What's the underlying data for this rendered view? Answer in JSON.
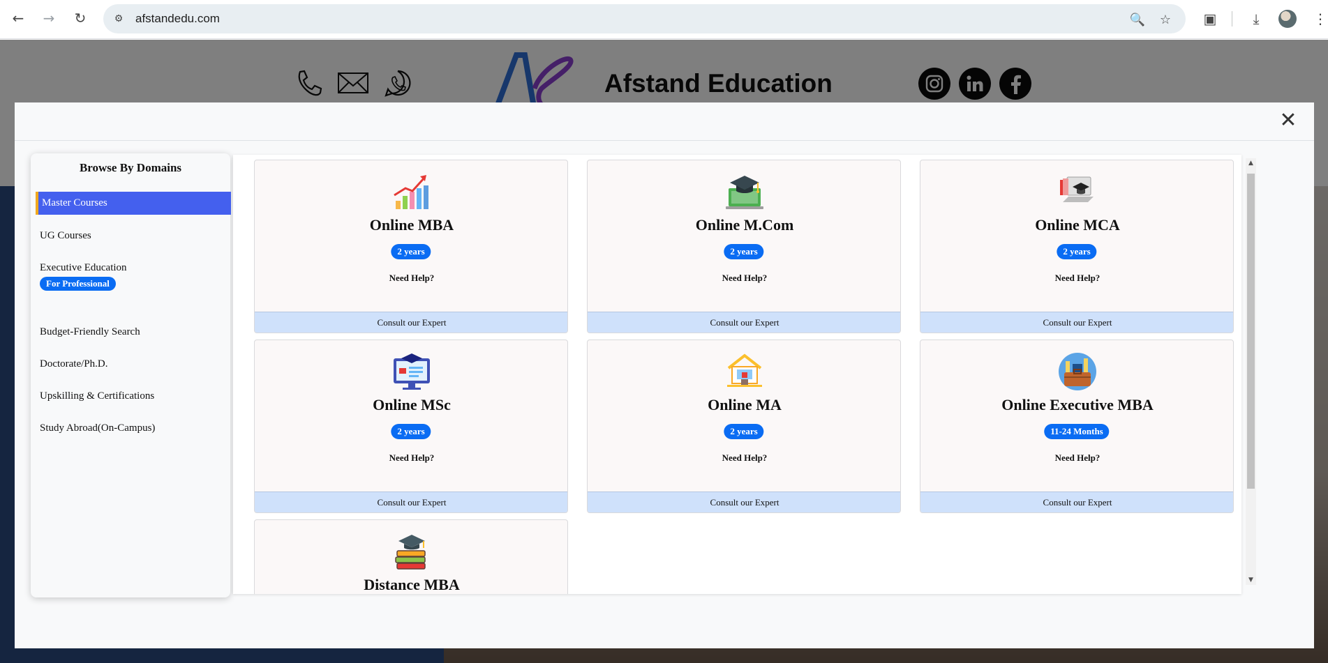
{
  "browser": {
    "url": "afstandedu.com"
  },
  "site": {
    "brand": "Afstand Education"
  },
  "modal": {
    "sidebar": {
      "title": "Browse By Domains",
      "items": [
        {
          "label": "Master Courses",
          "active": true
        },
        {
          "label": "UG Courses"
        },
        {
          "label": "Executive Education",
          "badge": "For Professional"
        },
        {
          "label": "Budget-Friendly Search"
        },
        {
          "label": "Doctorate/Ph.D."
        },
        {
          "label": "Upskilling & Certifications"
        },
        {
          "label": "Study Abroad(On-Campus)"
        }
      ]
    },
    "courses": [
      {
        "title": "Online MBA",
        "duration": "2 years",
        "help": "Need Help?",
        "cta": "Consult our Expert",
        "icon": "growth-chart-icon"
      },
      {
        "title": "Online M.Com",
        "duration": "2 years",
        "help": "Need Help?",
        "cta": "Consult our Expert",
        "icon": "laptop-graduation-cap-icon"
      },
      {
        "title": "Online MCA",
        "duration": "2 years",
        "help": "Need Help?",
        "cta": "Consult our Expert",
        "icon": "laptop-books-cap-icon"
      },
      {
        "title": "Online MSc",
        "duration": "2 years",
        "help": "Need Help?",
        "cta": "Consult our Expert",
        "icon": "monitor-cap-icon"
      },
      {
        "title": "Online MA",
        "duration": "2 years",
        "help": "Need Help?",
        "cta": "Consult our Expert",
        "icon": "home-study-icon"
      },
      {
        "title": "Online Executive MBA",
        "duration": "11-24 Months",
        "help": "Need Help?",
        "cta": "Consult our Expert",
        "icon": "briefcase-city-icon"
      },
      {
        "title": "Distance MBA",
        "icon": "books-cap-icon"
      }
    ]
  }
}
